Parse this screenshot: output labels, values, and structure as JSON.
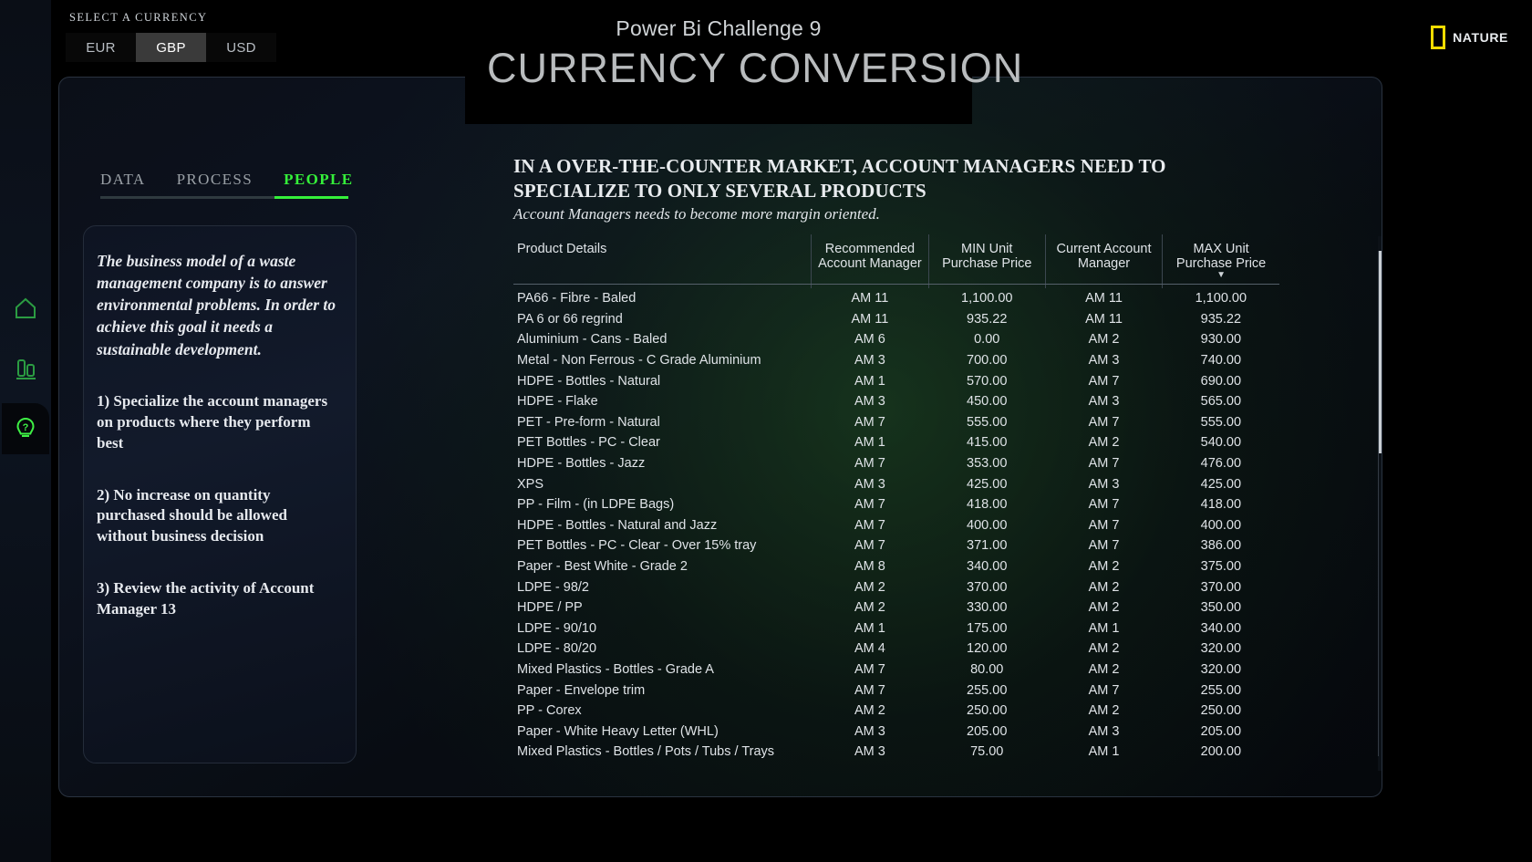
{
  "header": {
    "currency_label": "SELECT A CURRENCY",
    "currencies": [
      {
        "code": "EUR",
        "selected": false
      },
      {
        "code": "GBP",
        "selected": true
      },
      {
        "code": "USD",
        "selected": false
      }
    ],
    "title_sub": "Power Bi Challenge 9",
    "title_main": "CURRENCY CONVERSION",
    "brand": "NATURE"
  },
  "rail": {
    "items": [
      {
        "name": "home-icon"
      },
      {
        "name": "bar-chart-icon"
      },
      {
        "name": "lightbulb-question-icon"
      }
    ]
  },
  "tabs": [
    {
      "label": "DATA",
      "active": false
    },
    {
      "label": "PROCESS",
      "active": false
    },
    {
      "label": "PEOPLE",
      "active": true
    }
  ],
  "narrative": {
    "lede": "The business model of a waste management company is to answer environmental problems. In order to achieve this goal it needs a sustainable development.",
    "points": [
      "1) Specialize the account managers on products where they perform best",
      "2) No increase on quantity purchased should be allowed without business decision",
      "3) Review the activity of Account Manager 13"
    ]
  },
  "main": {
    "headline": "IN A OVER-THE-COUNTER MARKET, ACCOUNT MANAGERS NEED TO SPECIALIZE TO ONLY SEVERAL PRODUCTS",
    "subhead": "Account Managers needs to become more margin oriented."
  },
  "table": {
    "columns": [
      {
        "line1": "Product Details",
        "line2": "",
        "sorted": false
      },
      {
        "line1": "Recommended",
        "line2": "Account Manager",
        "sorted": false
      },
      {
        "line1": "MIN Unit",
        "line2": "Purchase Price",
        "sorted": false
      },
      {
        "line1": "Current Account",
        "line2": "Manager",
        "sorted": false
      },
      {
        "line1": "MAX Unit",
        "line2": "Purchase Price",
        "sorted": true
      }
    ],
    "sort_caret": "▼",
    "rows": [
      [
        "PA66 - Fibre - Baled",
        "AM 11",
        "1,100.00",
        "AM 11",
        "1,100.00"
      ],
      [
        "PA 6 or 66 regrind",
        "AM 11",
        "935.22",
        "AM 11",
        "935.22"
      ],
      [
        "Aluminium - Cans - Baled",
        "AM 6",
        "0.00",
        "AM 2",
        "930.00"
      ],
      [
        "Metal - Non Ferrous - C Grade Aluminium",
        "AM 3",
        "700.00",
        "AM 3",
        "740.00"
      ],
      [
        "HDPE - Bottles - Natural",
        "AM 1",
        "570.00",
        "AM 7",
        "690.00"
      ],
      [
        "HDPE - Flake",
        "AM 3",
        "450.00",
        "AM 3",
        "565.00"
      ],
      [
        "PET - Pre-form - Natural",
        "AM 7",
        "555.00",
        "AM 7",
        "555.00"
      ],
      [
        "PET Bottles - PC - Clear",
        "AM 1",
        "415.00",
        "AM 2",
        "540.00"
      ],
      [
        "HDPE - Bottles - Jazz",
        "AM 7",
        "353.00",
        "AM 7",
        "476.00"
      ],
      [
        "XPS",
        "AM 3",
        "425.00",
        "AM 3",
        "425.00"
      ],
      [
        "PP - Film - (in LDPE Bags)",
        "AM 7",
        "418.00",
        "AM 7",
        "418.00"
      ],
      [
        "HDPE - Bottles - Natural and Jazz",
        "AM 7",
        "400.00",
        "AM 7",
        "400.00"
      ],
      [
        "PET Bottles - PC - Clear - Over 15% tray",
        "AM 7",
        "371.00",
        "AM 7",
        "386.00"
      ],
      [
        "Paper - Best White - Grade 2",
        "AM 8",
        "340.00",
        "AM 2",
        "375.00"
      ],
      [
        "LDPE - 98/2",
        "AM 2",
        "370.00",
        "AM 2",
        "370.00"
      ],
      [
        "HDPE / PP",
        "AM 2",
        "330.00",
        "AM 2",
        "350.00"
      ],
      [
        "LDPE - 90/10",
        "AM 1",
        "175.00",
        "AM 1",
        "340.00"
      ],
      [
        "LDPE - 80/20",
        "AM 4",
        "120.00",
        "AM 2",
        "320.00"
      ],
      [
        "Mixed Plastics - Bottles - Grade A",
        "AM 7",
        "80.00",
        "AM 2",
        "320.00"
      ],
      [
        "Paper - Envelope trim",
        "AM 7",
        "255.00",
        "AM 7",
        "255.00"
      ],
      [
        "PP - Corex",
        "AM 2",
        "250.00",
        "AM 2",
        "250.00"
      ],
      [
        "Paper - White Heavy Letter (WHL)",
        "AM 3",
        "205.00",
        "AM 3",
        "205.00"
      ],
      [
        "Mixed Plastics - Bottles / Pots / Tubs / Trays",
        "AM 3",
        "75.00",
        "AM 1",
        "200.00"
      ]
    ]
  },
  "scrollbar": {
    "up": "▲",
    "down": "▼"
  },
  "colors": {
    "accent_green": "#35f03a",
    "brand_yellow": "#f2dc00",
    "selected_tab_bg": "#3a3a3a"
  }
}
